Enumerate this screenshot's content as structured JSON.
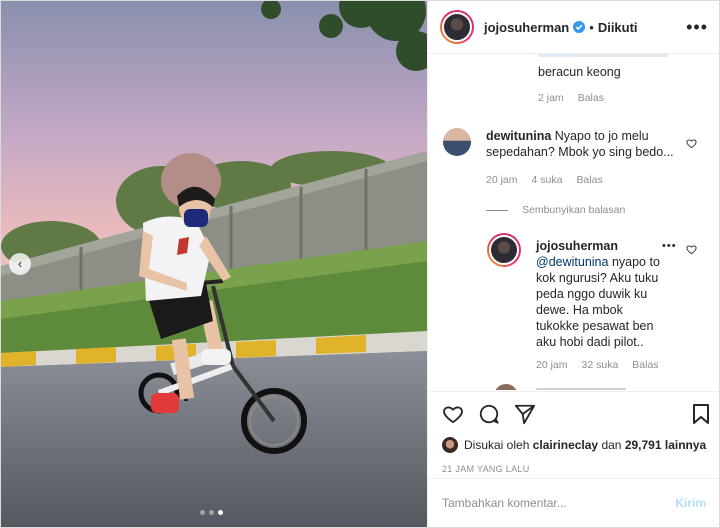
{
  "header": {
    "username": "jojosuherman",
    "separator": "•",
    "follow_status": "Diikuti",
    "more_label": "•••"
  },
  "comments": [
    {
      "partial": true,
      "text": "beracun keong",
      "time": "2 jam",
      "reply_label": "Balas"
    },
    {
      "username": "dewitunina",
      "text": "Nyapo to jo melu sepedahan? Mbok yo sing bedo...",
      "time": "20 jam",
      "likes": "4 suka",
      "reply_label": "Balas",
      "hide_replies_label": "Sembunyikan balasan"
    },
    {
      "username": "jojosuherman",
      "mention": "@dewitunina",
      "text": "nyapo to kok ngurusi? Aku tuku peda nggo duwik ku dewe. Ha mbok tukokke pesawat ben aku hobi dadi pilot..",
      "time": "20 jam",
      "likes": "32 suka",
      "reply_label": "Balas",
      "more_label": "•••"
    }
  ],
  "likes": {
    "prefix": "Disukai oleh",
    "user": "clairineclay",
    "joiner": "dan",
    "count": "29,791 lainnya"
  },
  "timestamp": "21 JAM YANG LALU",
  "comment_box": {
    "placeholder": "Tambahkan komentar...",
    "post_label": "Kirim"
  },
  "carousel": {
    "prev_label": "‹",
    "current_index": 3,
    "total": 3
  },
  "colors": {
    "verified": "#3897f0",
    "post_button_disabled": "#b2dffc",
    "meta_text": "#8e8e8e"
  }
}
